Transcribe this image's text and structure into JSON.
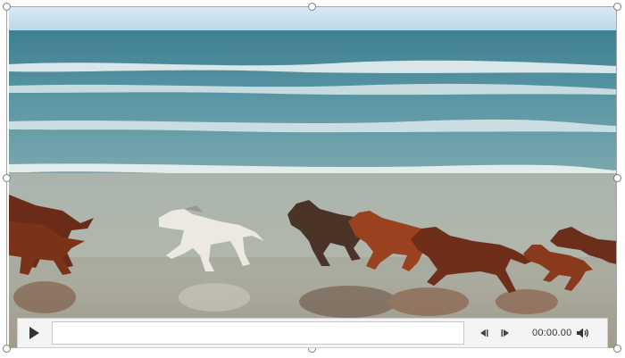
{
  "media_player": {
    "time_display": "00:00.00",
    "icons": {
      "play": "play-icon",
      "previous": "skip-back-icon",
      "next": "skip-forward-icon",
      "volume": "volume-icon"
    }
  },
  "colors": {
    "sky": "#cfe4f3",
    "sea": "#4f8fa0",
    "sand": "#a8b2aa",
    "control_bar": "#f4f4f4"
  }
}
